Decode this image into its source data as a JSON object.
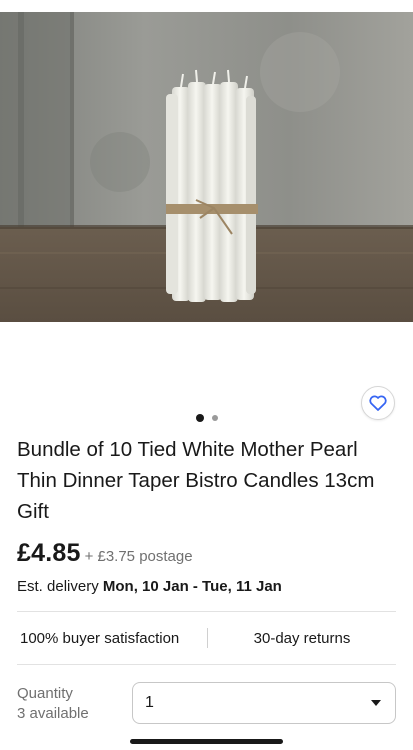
{
  "product": {
    "image_alt": "Bundle of white taper candles tied with twine",
    "carousel_dots": 2,
    "active_dot": 0,
    "title": "Bundle of 10 Tied White Mother Pearl Thin Dinner Taper Bistro Candles 13cm Gift",
    "price": "£4.85",
    "postage": "+ £3.75 postage",
    "delivery_prefix": "Est. delivery ",
    "delivery_dates": "Mon, 10 Jan - Tue, 11 Jan"
  },
  "badges": {
    "satisfaction": "100% buyer satisfaction",
    "returns": "30-day returns"
  },
  "quantity": {
    "label": "Quantity",
    "available": "3 available",
    "selected": "1"
  },
  "colors": {
    "accent": "#3665f3",
    "text": "#191919",
    "muted": "#707070"
  }
}
